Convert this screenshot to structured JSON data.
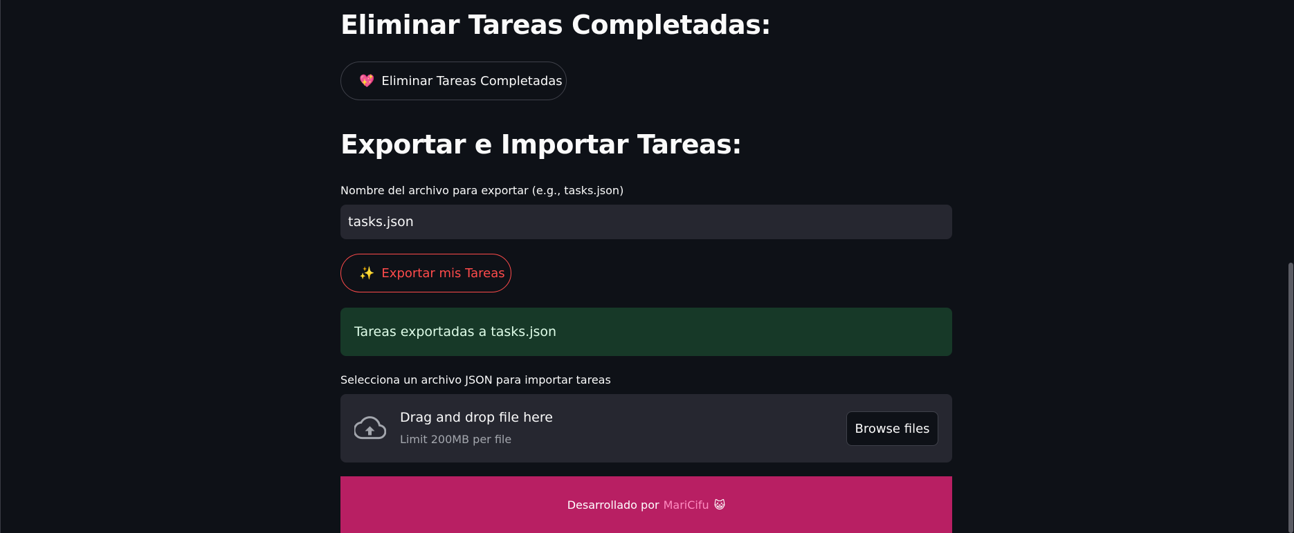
{
  "sections": {
    "delete": {
      "heading": "Eliminar Tareas Completadas:",
      "button_emoji": "💖",
      "button_label": "Eliminar Tareas Completadas"
    },
    "export_import": {
      "heading": "Exportar e Importar Tareas:",
      "filename_label": "Nombre del archivo para exportar (e.g., tasks.json)",
      "filename_value": "tasks.json",
      "export_button_emoji": "✨",
      "export_button_label": "Exportar mis Tareas",
      "success_message": "Tareas exportadas a tasks.json",
      "import_label": "Selecciona un archivo JSON para importar tareas",
      "dropzone": {
        "title": "Drag and drop file here",
        "subtitle": "Limit 200MB per file",
        "browse_label": "Browse files",
        "icon": "cloud-upload-icon"
      }
    }
  },
  "footer": {
    "prefix": "Desarrollado por",
    "author": "MariCifu",
    "emoji": "😺"
  },
  "colors": {
    "background": "#0e1117",
    "input_bg": "#262730",
    "accent_red": "#ff4b4b",
    "success_bg": "#173928",
    "footer_bg": "#b81f63",
    "footer_link": "#ff8ac0"
  }
}
